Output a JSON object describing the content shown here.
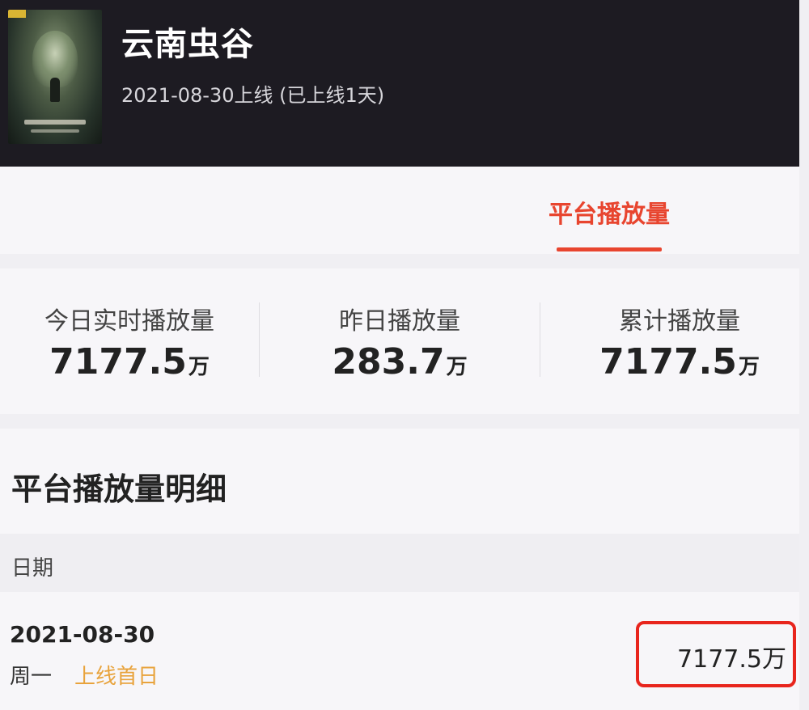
{
  "header": {
    "title": "云南虫谷",
    "release_info": "2021-08-30上线 (已上线1天)"
  },
  "tabs": [
    {
      "label": "平台播放量",
      "active": true
    }
  ],
  "stats": {
    "today": {
      "label": "今日实时播放量",
      "value": "7177.5",
      "unit": "万"
    },
    "yesterday": {
      "label": "昨日播放量",
      "value": "283.7",
      "unit": "万"
    },
    "total": {
      "label": "累计播放量",
      "value": "7177.5",
      "unit": "万"
    }
  },
  "detail": {
    "title": "平台播放量明细",
    "columns": {
      "date": "日期"
    },
    "rows": [
      {
        "date": "2021-08-30",
        "weekday": "周一",
        "badge": "上线首日",
        "plays": "7177.5万"
      }
    ]
  },
  "colors": {
    "accent": "#e8452f",
    "badge": "#e8a33c",
    "highlight": "#e8251d",
    "header_bg": "#1d1b22"
  }
}
